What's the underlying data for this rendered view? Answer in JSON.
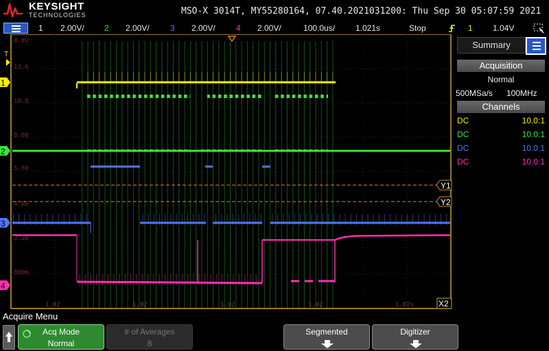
{
  "header": {
    "brand": "KEYSIGHT",
    "brand_sub": "TECHNOLOGIES",
    "device_info": "MSO-X 3014T, MY55280164, 07.40.2021031200: Thu Sep 30 05:07:59 2021"
  },
  "channels_bar": {
    "ch1_num": "1",
    "ch1_scale": "2.00V/",
    "ch2_num": "2",
    "ch2_scale": "2.00V/",
    "ch3_num": "3",
    "ch3_scale": "2.00V/",
    "ch4_num": "4",
    "ch4_scale": "2.00V/",
    "timebase": "100.0us/",
    "delay": "1.021s",
    "run_state": "Stop",
    "trigger_source": "1",
    "trigger_level": "1.04V"
  },
  "waveform": {
    "left_labels": [
      "4.8V",
      "13.6",
      "10.8",
      "8.00",
      "5.60",
      "4.00",
      "3.20",
      "800m"
    ],
    "bottom_labels": [
      "1.02",
      "1.02",
      "1.02",
      "1.02",
      "1.02s"
    ],
    "markers": {
      "ch1": "1",
      "ch2": "2",
      "ch3": "3",
      "ch4": "4",
      "trig": "T",
      "cursor_y1": "Y1",
      "cursor_y2": "Y2",
      "cursor_x2": "X2"
    }
  },
  "right_panel": {
    "summary_label": "Summary",
    "acquisition_header": "Acquisition",
    "acq_mode": "Normal",
    "sample_rate": "500MSa/s",
    "bandwidth": "100MHz",
    "channels_header": "Channels",
    "channels": [
      {
        "coupling": "DC",
        "probe": "10.0:1",
        "color": "#f6f000"
      },
      {
        "coupling": "DC",
        "probe": "10.0:1",
        "color": "#3ce63c"
      },
      {
        "coupling": "DC",
        "probe": "10.0:1",
        "color": "#4f78ff"
      },
      {
        "coupling": "DC",
        "probe": "10.0:1",
        "color": "#ff2fb4"
      }
    ]
  },
  "softkeys": {
    "menu_title": "Acquire Menu",
    "acq_mode_label": "Acq Mode",
    "acq_mode_value": "Normal",
    "averages_label": "# of Averages",
    "averages_value": "8",
    "segmented_label": "Segmented",
    "digitizer_label": "Digitizer"
  },
  "colors": {
    "ch1": "#f6f000",
    "ch2": "#3ce63c",
    "ch3": "#4f78ff",
    "ch4": "#ff2fb4",
    "graticule_border": "#c9a227",
    "cursor": "#d88a3a"
  }
}
